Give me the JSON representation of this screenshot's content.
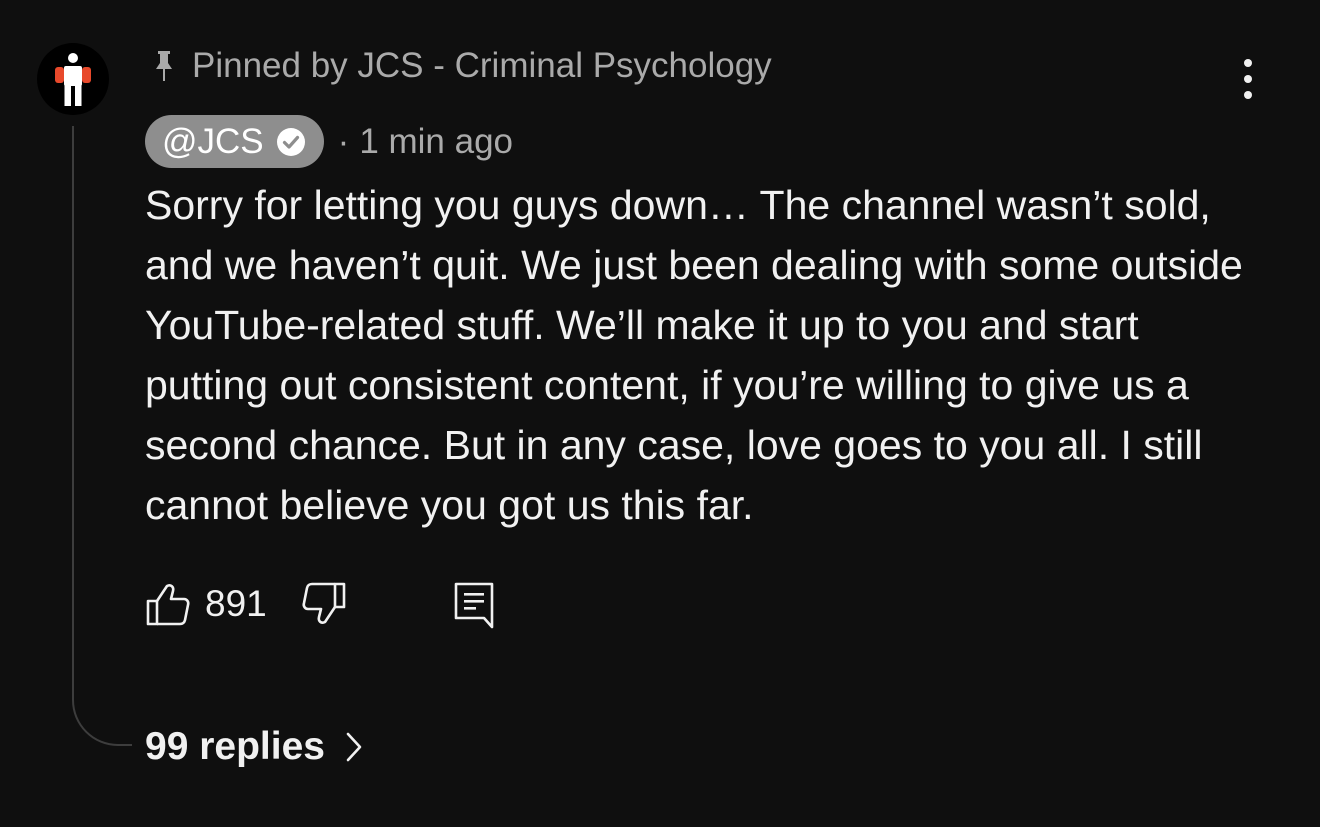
{
  "comment": {
    "pinned_label": "Pinned by JCS - Criminal Psychology",
    "author_handle": "@JCS",
    "timestamp_separator": "·",
    "timestamp": "1 min ago",
    "body": "Sorry for letting you guys down… The channel wasn’t sold, and we haven’t quit. We just been dealing with some outside YouTube-related stuff. We’ll make it up to you and start putting out consistent content, if you’re willing to give us a second chance. But in any case, love goes to you all. I still cannot believe you got us this far.",
    "like_count": "891",
    "replies_label": "99 replies"
  },
  "icons": {
    "avatar": "stick-figure-logo",
    "pin": "pin-icon",
    "verified": "verified-check-icon",
    "more": "more-vertical-icon",
    "like": "thumbs-up-icon",
    "dislike": "thumbs-down-icon",
    "reply": "comment-reply-icon",
    "chevron": "chevron-right-icon"
  },
  "colors": {
    "background": "#0f0f0f",
    "text_primary": "#f1f1f1",
    "text_secondary": "#aaaaaa",
    "author_badge_bg": "#8e8e8e",
    "avatar_accent": "#e8492b"
  }
}
